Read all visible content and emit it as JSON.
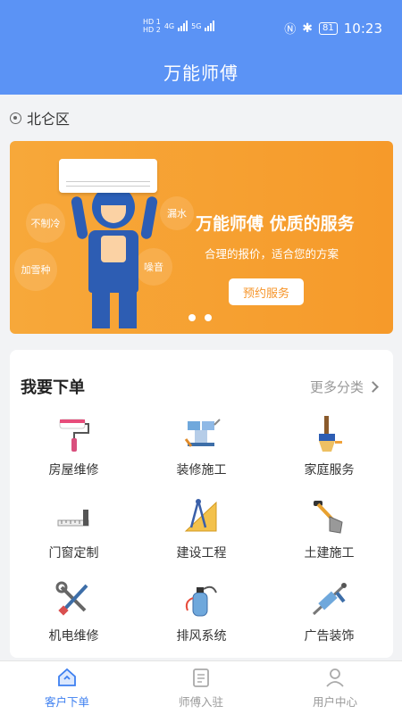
{
  "status_bar": {
    "sim1": "HD 1",
    "sim2": "HD 2",
    "net1": "4G",
    "net2": "5G",
    "battery": "81",
    "time": "10:23"
  },
  "header": {
    "title": "万能师傅"
  },
  "location": {
    "name": "北仑区"
  },
  "banner": {
    "title": "万能师傅 优质的服务",
    "subtitle": "合理的报价，适合您的方案",
    "button": "预约服务",
    "bubbles": [
      "不制冷",
      "加雪种",
      "漏水",
      "噪音"
    ]
  },
  "orders": {
    "title": "我要下单",
    "more": "更多分类",
    "categories": [
      {
        "label": "房屋维修",
        "icon": "paint-roller-icon"
      },
      {
        "label": "装修施工",
        "icon": "vise-icon"
      },
      {
        "label": "家庭服务",
        "icon": "brush-icon"
      },
      {
        "label": "门窗定制",
        "icon": "ruler-icon"
      },
      {
        "label": "建设工程",
        "icon": "compass-icon"
      },
      {
        "label": "土建施工",
        "icon": "shovel-icon"
      },
      {
        "label": "机电维修",
        "icon": "tools-icon"
      },
      {
        "label": "排风系统",
        "icon": "sprayer-icon"
      },
      {
        "label": "广告装饰",
        "icon": "caulk-gun-icon"
      }
    ]
  },
  "tabbar": {
    "tabs": [
      {
        "label": "客户下单",
        "active": true
      },
      {
        "label": "师傅入驻",
        "active": false
      },
      {
        "label": "用户中心",
        "active": false
      }
    ]
  },
  "colors": {
    "primary": "#5b93f5",
    "banner": "#f7a83a",
    "active_tab": "#3d7ff0"
  }
}
